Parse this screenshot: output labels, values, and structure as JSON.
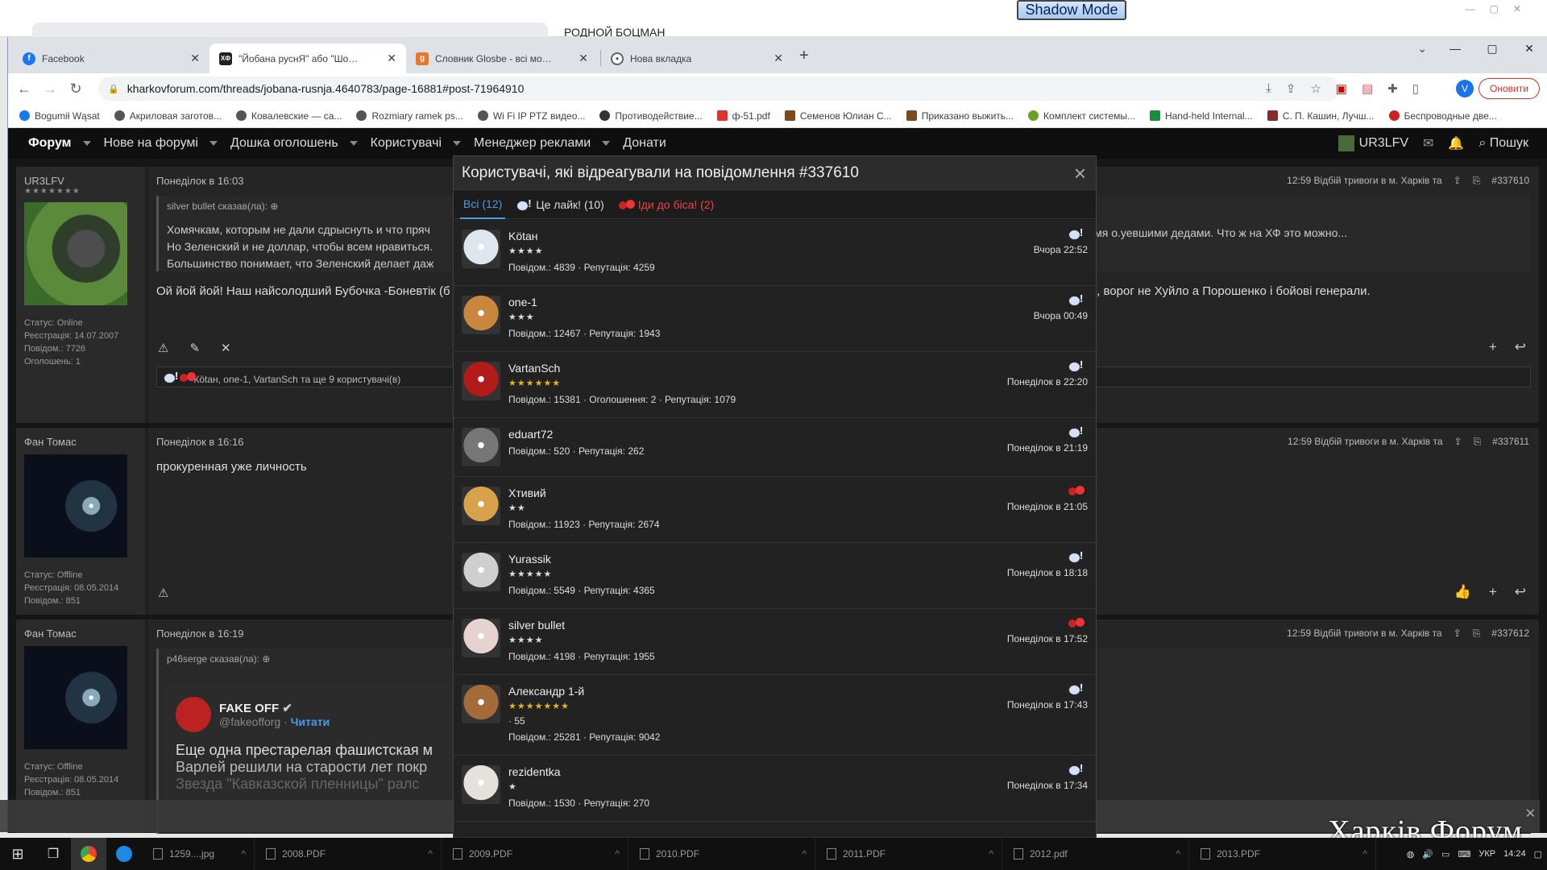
{
  "shadow_mode": "Shadow Mode",
  "bg_window_title": "РОДНОЙ БОЦМАН",
  "tabs": [
    {
      "title": "Facebook",
      "icon": "facebook-icon",
      "color": "#1877f2",
      "glyph": "f"
    },
    {
      "title": "\"Йобана руснЯ\" або \"Шо там у",
      "icon": "xf-icon",
      "color": "#222222",
      "glyph": "XФ"
    },
    {
      "title": "Словник Glosbe - всі мови в од",
      "icon": "glosbe-icon",
      "color": "#e8762b",
      "glyph": "g"
    },
    {
      "title": "Нова вкладка",
      "icon": "chrome-icon",
      "color": "#5f6368",
      "glyph": "◉"
    }
  ],
  "url": "kharkovforum.com/threads/jobana-rusnja.4640783/page-16881#post-71964910",
  "profile_letter": "V",
  "update_label": "Оновити",
  "bookmarks": [
    "Bogumił Wąsat",
    "Акриловая заготов...",
    "Ковалевские — са...",
    "Rozmiary ramek ps...",
    "Wi Fi IP PTZ видео...",
    "Противодействие...",
    "ф-51.pdf",
    "Семенов Юлиан С...",
    "Приказано выжить...",
    "Комплект системы...",
    "Hand-held Internal...",
    "С. П. Кашин, Лучш...",
    "Беспроводные две..."
  ],
  "forum_nav": {
    "items": [
      "Форум",
      "Нове на форумі",
      "Дошка оголошень",
      "Користувачі",
      "Менеджер реклами",
      "Донати"
    ],
    "user": "UR3LFV",
    "search": "Пошук"
  },
  "posts": [
    {
      "user": "UR3LFV",
      "stars": "★★★★★★★",
      "stats": [
        "Статус: Online",
        "Реєстрація: 14.07.2007",
        "Повідом.: 7726",
        "Оголошень: 1"
      ],
      "date": "Понеділок в 16:03",
      "meta": "12:59 Відбій тривоги в м. Харків та",
      "id": "#337610",
      "quote_head": "silver bullet сказав(ла):",
      "quote_lines": [
        "Хомячкам, которым не дали сдрыснуть и что пряч",
        "Но Зеленский и не доллар, чтобы всем нравиться.",
        "Большинство понимает, что Зеленский делает даж"
      ],
      "quote_right": "зумя о.уевшими дедами. Что ж на ХФ это можно...",
      "text": "Ой йой йой! Наш найсолодший Бубочка -Боневтік (б",
      "text_right": "осі, ворог не Хуйло а Порошенко і бойові генерали.",
      "reactions": "Кötан, one-1, VartanSch та ще 9 користувачі(в)"
    },
    {
      "user": "Фан Томас",
      "stats": [
        "Статус: Offline",
        "Реєстрація: 08.05.2014",
        "Повідом.: 851"
      ],
      "date": "Понеділок в 16:16",
      "meta": "12:59 Відбій тривоги в м. Харків та",
      "id": "#337611",
      "text": "прокуренная уже личность"
    },
    {
      "user": "Фан Томас",
      "stats": [
        "Статус: Offline",
        "Реєстрація: 08.05.2014",
        "Повідом.: 851"
      ],
      "date": "Понеділок в 16:19",
      "meta": "12:59 Відбій тривоги в м. Харків та",
      "id": "#337612",
      "quote_head": "p46serge сказав(ла):",
      "tweet_name": "FAKE OFF",
      "tweet_handle": "@fakeofforg · ",
      "tweet_follow": "Читати",
      "tweet_lines": [
        "Еще одна престарелая фашистская м",
        "Варлей решили на старости лет покр",
        "Звезда \"Кавказской пленницы\" ралс"
      ]
    }
  ],
  "modal": {
    "title": "Користувачі, які відреагували на повідомлення #337610",
    "tabs": [
      {
        "label": "Всі (12)"
      },
      {
        "label": "Це лайк! (10)",
        "icon": "like"
      },
      {
        "label": "Іди до біса! (2)",
        "icon": "devil"
      }
    ],
    "rows": [
      {
        "name": "Kötан",
        "stars": "★★★★",
        "stats": "Повідом.: 4839 · Репутація: 4259",
        "time": "Вчора 22:52",
        "react": "like",
        "av": "#dfe6ee"
      },
      {
        "name": "one-1",
        "stars": "★★★",
        "stats": "Повідом.: 12467 · Репутація: 1943",
        "time": "Вчора 00:49",
        "react": "like",
        "av": "#c9873e"
      },
      {
        "name": "VartanSch",
        "stars": "★★★★★★",
        "stats": "Повідом.: 15381 · Оголошення: 2 · Репутація: 1079",
        "time": "Понеділок в 22:20",
        "react": "like",
        "av": "#b31b1b"
      },
      {
        "name": "eduart72",
        "stars": "",
        "stats": "Повідом.: 520 · Репутація: 262",
        "time": "Понеділок в 21:19",
        "react": "like",
        "av": "#777777"
      },
      {
        "name": "Хтивий",
        "stars": "★★",
        "stats": "Повідом.: 11923 · Репутація: 2674",
        "time": "Понеділок в 21:05",
        "react": "devil",
        "av": "#d7a24a"
      },
      {
        "name": "Yurassik",
        "stars": "★★★★★",
        "stats": "Повідом.: 5549 · Репутація: 4365",
        "time": "Понеділок в 18:18",
        "react": "like",
        "av": "#cfcfcf"
      },
      {
        "name": "silver bullet",
        "stars": "★★★★",
        "stats": "Повідом.: 4198 · Репутація: 1955",
        "time": "Понеділок в 17:52",
        "react": "devil",
        "av": "#e6d3cf"
      },
      {
        "name": "Александр 1-й",
        "stars": "★★★★★★★",
        "extra": "· 55",
        "stats": "Повідом.: 25281 · Репутація: 9042",
        "time": "Понеділок в 17:43",
        "react": "like",
        "av": "#a46a3a"
      },
      {
        "name": "rezidentka",
        "stars": "★",
        "stats": "Повідом.: 1530 · Репутація: 270",
        "time": "Понеділок в 17:34",
        "react": "like",
        "av": "#e7e1dc"
      }
    ]
  },
  "overlay_logo": "Харків Форум",
  "taskbar": {
    "items": [
      "1259....jpg",
      "2008.PDF",
      "2009.PDF",
      "2010.PDF",
      "2011.PDF",
      "2012.pdf",
      "2013.PDF"
    ],
    "lang": "УКР",
    "time": "14:24"
  }
}
